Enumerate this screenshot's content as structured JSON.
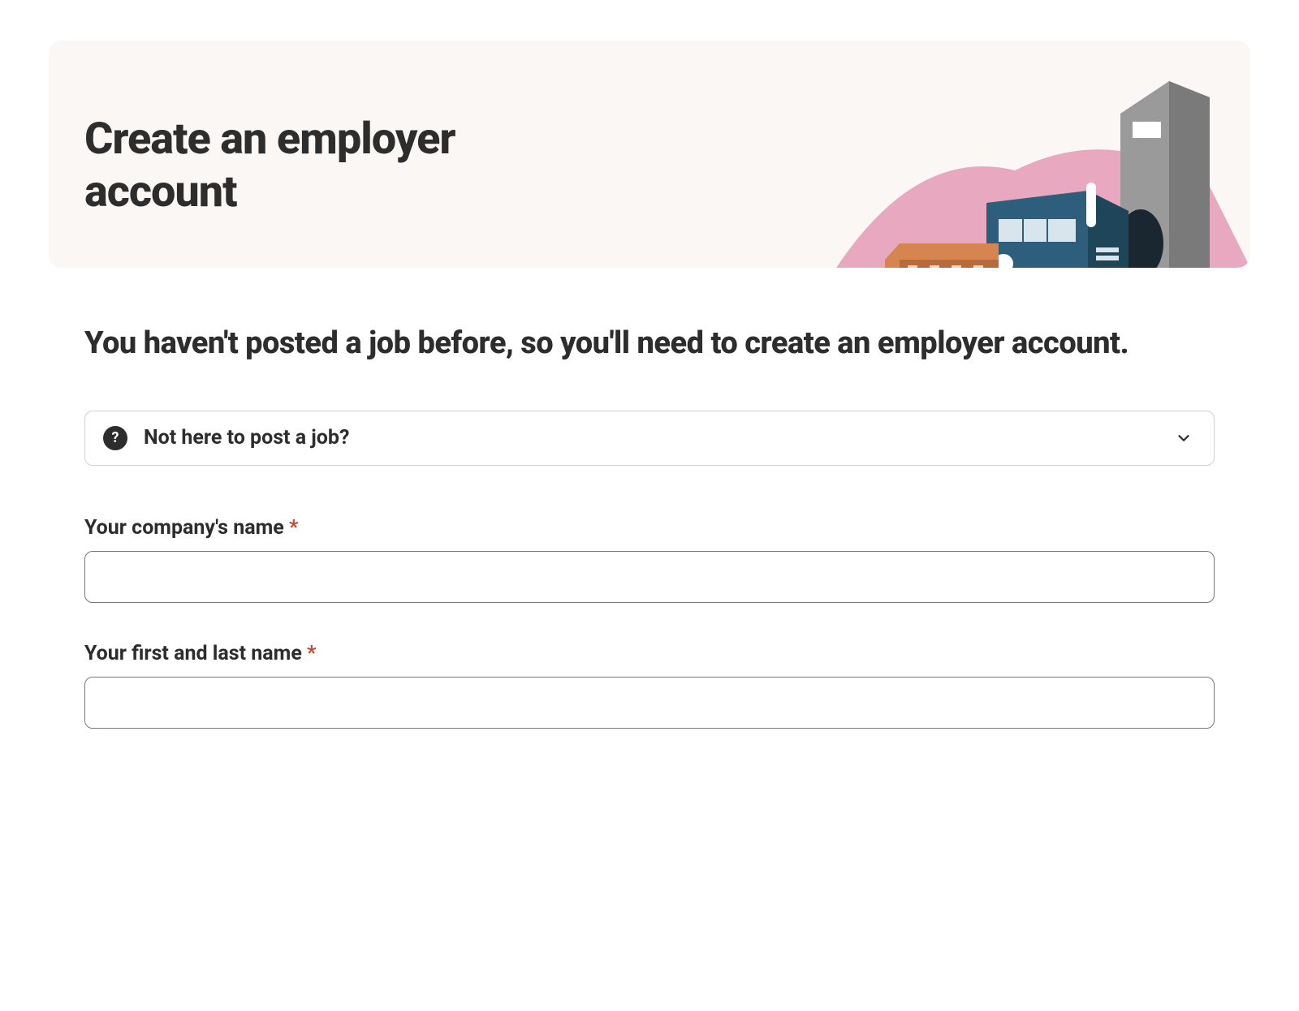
{
  "hero": {
    "title": "Create an employer account"
  },
  "main": {
    "subtitle": "You haven't posted a job before, so you'll need to create an employer account.",
    "accordion": {
      "label": "Not here to post a job?"
    },
    "form": {
      "company_name": {
        "label": "Your company's name",
        "value": ""
      },
      "full_name": {
        "label": "Your first and last name",
        "value": ""
      }
    }
  }
}
